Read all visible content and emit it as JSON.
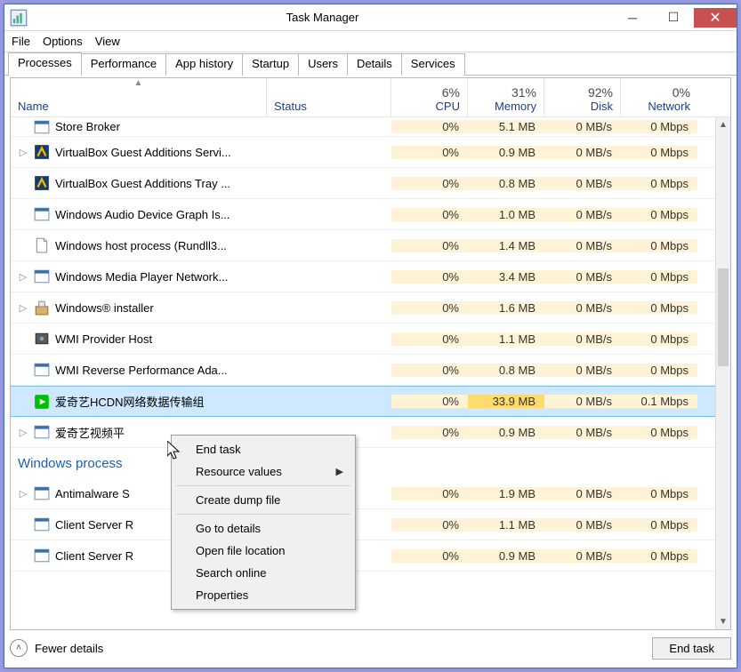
{
  "window": {
    "title": "Task Manager"
  },
  "menu": {
    "file": "File",
    "options": "Options",
    "view": "View"
  },
  "tabs": [
    "Processes",
    "Performance",
    "App history",
    "Startup",
    "Users",
    "Details",
    "Services"
  ],
  "active_tab": 0,
  "columns": {
    "name": "Name",
    "status": "Status",
    "cpu": {
      "pct": "6%",
      "label": "CPU"
    },
    "mem": {
      "pct": "31%",
      "label": "Memory"
    },
    "disk": {
      "pct": "92%",
      "label": "Disk"
    },
    "net": {
      "pct": "0%",
      "label": "Network"
    }
  },
  "processes": [
    {
      "name": "Store Broker",
      "cpu": "0%",
      "mem": "5.1 MB",
      "disk": "0 MB/s",
      "net": "0 Mbps",
      "expand": false,
      "icon": "app",
      "first": true
    },
    {
      "name": "VirtualBox Guest Additions Servi...",
      "cpu": "0%",
      "mem": "0.9 MB",
      "disk": "0 MB/s",
      "net": "0 Mbps",
      "expand": true,
      "icon": "vbox"
    },
    {
      "name": "VirtualBox Guest Additions Tray ...",
      "cpu": "0%",
      "mem": "0.8 MB",
      "disk": "0 MB/s",
      "net": "0 Mbps",
      "expand": false,
      "icon": "vbox"
    },
    {
      "name": "Windows Audio Device Graph Is...",
      "cpu": "0%",
      "mem": "1.0 MB",
      "disk": "0 MB/s",
      "net": "0 Mbps",
      "expand": false,
      "icon": "app"
    },
    {
      "name": "Windows host process (Rundll3...",
      "cpu": "0%",
      "mem": "1.4 MB",
      "disk": "0 MB/s",
      "net": "0 Mbps",
      "expand": false,
      "icon": "file"
    },
    {
      "name": "Windows Media Player Network...",
      "cpu": "0%",
      "mem": "3.4 MB",
      "disk": "0 MB/s",
      "net": "0 Mbps",
      "expand": true,
      "icon": "app"
    },
    {
      "name": "Windows® installer",
      "cpu": "0%",
      "mem": "1.6 MB",
      "disk": "0 MB/s",
      "net": "0 Mbps",
      "expand": true,
      "icon": "installer"
    },
    {
      "name": "WMI Provider Host",
      "cpu": "0%",
      "mem": "1.1 MB",
      "disk": "0 MB/s",
      "net": "0 Mbps",
      "expand": false,
      "icon": "wmi"
    },
    {
      "name": "WMI Reverse Performance Ada...",
      "cpu": "0%",
      "mem": "0.8 MB",
      "disk": "0 MB/s",
      "net": "0 Mbps",
      "expand": false,
      "icon": "app"
    },
    {
      "name": "爱奇艺HCDN网络数据传输组",
      "cpu": "0%",
      "mem": "33.9 MB",
      "disk": "0 MB/s",
      "net": "0.1 Mbps",
      "expand": false,
      "icon": "iqiyi",
      "selected": true,
      "memheat": 3
    },
    {
      "name": "爱奇艺视频平",
      "cpu": "0%",
      "mem": "0.9 MB",
      "disk": "0 MB/s",
      "net": "0 Mbps",
      "expand": true,
      "icon": "app"
    }
  ],
  "group": {
    "label": "Windows process"
  },
  "group_processes": [
    {
      "name": "Antimalware S",
      "cpu": "0%",
      "mem": "1.9 MB",
      "disk": "0 MB/s",
      "net": "0 Mbps",
      "expand": true,
      "icon": "app"
    },
    {
      "name": "Client Server R",
      "cpu": "0%",
      "mem": "1.1 MB",
      "disk": "0 MB/s",
      "net": "0 Mbps",
      "expand": false,
      "icon": "app"
    },
    {
      "name": "Client Server R",
      "cpu": "0%",
      "mem": "0.9 MB",
      "disk": "0 MB/s",
      "net": "0 Mbps",
      "expand": false,
      "icon": "app"
    }
  ],
  "context_menu": {
    "end_task": "End task",
    "resource_values": "Resource values",
    "create_dump": "Create dump file",
    "go_to_details": "Go to details",
    "open_location": "Open file location",
    "search_online": "Search online",
    "properties": "Properties"
  },
  "footer": {
    "fewer": "Fewer details",
    "end_task": "End task"
  }
}
